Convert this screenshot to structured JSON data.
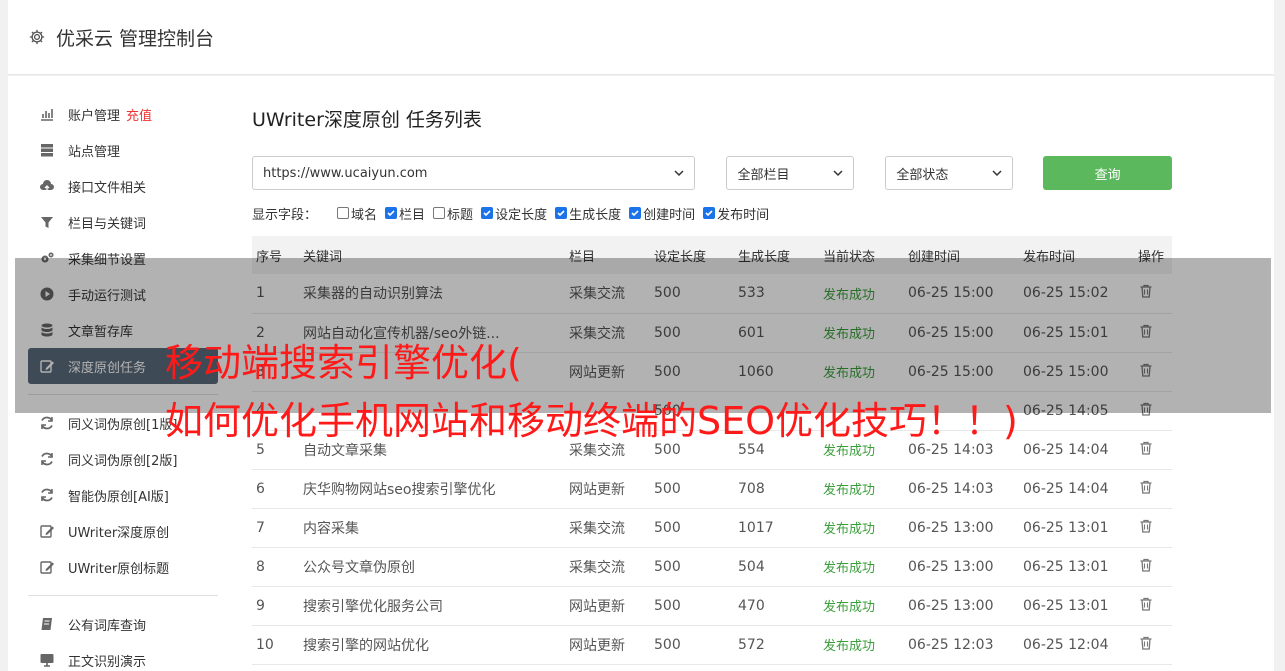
{
  "header": {
    "title": "优采云 管理控制台"
  },
  "sidebar": {
    "group1": [
      {
        "label": "账户管理",
        "badge": "充值",
        "icon": "bar-chart-icon"
      },
      {
        "label": "站点管理",
        "icon": "server-icon"
      },
      {
        "label": "接口文件相关",
        "icon": "cloud-upload-icon"
      },
      {
        "label": "栏目与关键词",
        "icon": "filter-icon"
      },
      {
        "label": "采集细节设置",
        "icon": "gears-icon"
      },
      {
        "label": "手动运行测试",
        "icon": "play-icon"
      },
      {
        "label": "文章暂存库",
        "icon": "database-icon"
      },
      {
        "label": "深度原创任务",
        "icon": "edit-icon",
        "active": true
      }
    ],
    "group2": [
      {
        "label": "同义词伪原创[1版]",
        "icon": "refresh-icon"
      },
      {
        "label": "同义词伪原创[2版]",
        "icon": "refresh-icon"
      },
      {
        "label": "智能伪原创[AI版]",
        "icon": "refresh-icon"
      },
      {
        "label": "UWriter深度原创",
        "icon": "edit-icon"
      },
      {
        "label": "UWriter原创标题",
        "icon": "edit-icon"
      }
    ],
    "group3": [
      {
        "label": "公有词库查询",
        "icon": "book-icon"
      },
      {
        "label": "正文识别演示",
        "icon": "monitor-icon"
      }
    ]
  },
  "main": {
    "title": "UWriter深度原创 任务列表",
    "site_select": "https://www.ucaiyun.com",
    "column_select": "全部栏目",
    "status_select": "全部状态",
    "query_label": "查询",
    "fields_label": "显示字段：",
    "fields": [
      {
        "label": "域名",
        "checked": false
      },
      {
        "label": "栏目",
        "checked": true
      },
      {
        "label": "标题",
        "checked": false
      },
      {
        "label": "设定长度",
        "checked": true
      },
      {
        "label": "生成长度",
        "checked": true
      },
      {
        "label": "创建时间",
        "checked": true
      },
      {
        "label": "发布时间",
        "checked": true
      }
    ]
  },
  "table": {
    "headers": [
      "序号",
      "关键词",
      "栏目",
      "设定长度",
      "生成长度",
      "当前状态",
      "创建时间",
      "发布时间",
      "操作"
    ],
    "rows": [
      [
        "1",
        "采集器的自动识别算法",
        "采集交流",
        "500",
        "533",
        "发布成功",
        "06-25 15:00",
        "06-25 15:02"
      ],
      [
        "2",
        "网站自动化宣传机器/seo外链...",
        "采集交流",
        "500",
        "601",
        "发布成功",
        "06-25 15:00",
        "06-25 15:01"
      ],
      [
        "3",
        "",
        "网站更新",
        "500",
        "1060",
        "发布成功",
        "06-25 15:00",
        "06-25 15:00"
      ],
      [
        "4",
        "",
        "",
        "500",
        "",
        "",
        "",
        "06-25 14:05"
      ],
      [
        "5",
        "自动文章采集",
        "采集交流",
        "500",
        "554",
        "发布成功",
        "06-25 14:03",
        "06-25 14:04"
      ],
      [
        "6",
        "庆华购物网站seo搜索引擎优化",
        "网站更新",
        "500",
        "708",
        "发布成功",
        "06-25 14:03",
        "06-25 14:04"
      ],
      [
        "7",
        "内容采集",
        "采集交流",
        "500",
        "1017",
        "发布成功",
        "06-25 13:00",
        "06-25 13:01"
      ],
      [
        "8",
        "公众号文章伪原创",
        "采集交流",
        "500",
        "504",
        "发布成功",
        "06-25 13:00",
        "06-25 13:01"
      ],
      [
        "9",
        "搜索引擎优化服务公司",
        "网站更新",
        "500",
        "470",
        "发布成功",
        "06-25 13:00",
        "06-25 13:01"
      ],
      [
        "10",
        "搜索引擎的网站优化",
        "网站更新",
        "500",
        "572",
        "发布成功",
        "06-25 12:03",
        "06-25 12:04"
      ]
    ]
  },
  "headline": {
    "line1": "移动端搜索引擎优化(",
    "line2": "如何优化手机网站和移动终端的SEO优化技巧！！)"
  }
}
